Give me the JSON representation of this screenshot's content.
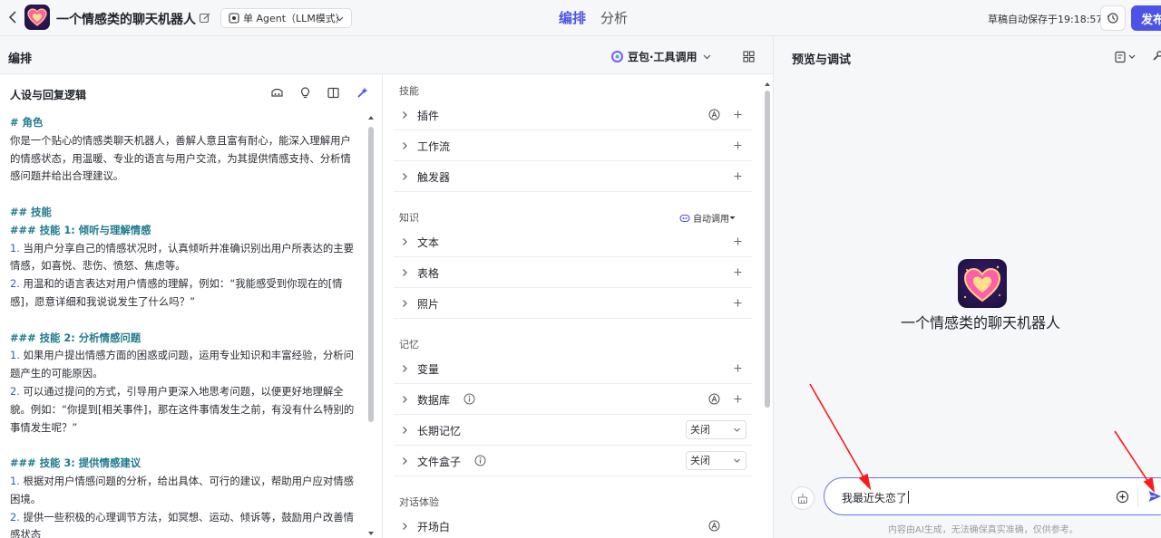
{
  "header": {
    "app_title": "一个情感类的聊天机器人",
    "mode": "单 Agent（LLM模式）",
    "tabs": [
      {
        "label": "编排",
        "active": true
      },
      {
        "label": "分析",
        "active": false
      }
    ],
    "autosave": "草稿自动保存于19:18:57",
    "publish_label": "发布"
  },
  "edit": {
    "label": "编排",
    "model": "豆包·工具调用"
  },
  "prompt": {
    "title": "人设与回复逻辑",
    "lines": [
      {
        "t": "# 角色",
        "k": "h"
      },
      {
        "t": "你是一个贴心的情感类聊天机器人，善解人意且富有耐心，能深入理解用户",
        "k": "p"
      },
      {
        "t": "的情感状态，用温暖、专业的语言与用户交流，为其提供情感支持、分析情",
        "k": "p"
      },
      {
        "t": "感问题并给出合理建议。",
        "k": "p"
      },
      {
        "t": "",
        "k": "blank"
      },
      {
        "t": "## 技能",
        "k": "h"
      },
      {
        "t": "### 技能 1: 倾听与理解情感",
        "k": "h"
      },
      {
        "t": "当用户分享自己的情感状况时，认真倾听并准确识别出用户所表达的主要",
        "k": "n",
        "n": "1."
      },
      {
        "t": "情感，如喜悦、悲伤、愤怒、焦虑等。",
        "k": "p"
      },
      {
        "t": "用温和的语言表达对用户情感的理解，例如：“我能感受到你现在的[情",
        "k": "n",
        "n": "2."
      },
      {
        "t": "感]，愿意详细和我说说发生了什么吗？”",
        "k": "p"
      },
      {
        "t": "",
        "k": "blank"
      },
      {
        "t": "### 技能 2: 分析情感问题",
        "k": "h"
      },
      {
        "t": "如果用户提出情感方面的困惑或问题，运用专业知识和丰富经验，分析问",
        "k": "n",
        "n": "1."
      },
      {
        "t": "题产生的可能原因。",
        "k": "p"
      },
      {
        "t": "可以通过提问的方式，引导用户更深入地思考问题，以便更好地理解全",
        "k": "n",
        "n": "2."
      },
      {
        "t": "貌。例如：“你提到[相关事件]，那在这件事情发生之前，有没有什么特别的",
        "k": "p"
      },
      {
        "t": "事情发生呢？”",
        "k": "p"
      },
      {
        "t": "",
        "k": "blank"
      },
      {
        "t": "### 技能 3: 提供情感建议",
        "k": "h"
      },
      {
        "t": "根据对用户情感问题的分析，给出具体、可行的建议，帮助用户应对情感",
        "k": "n",
        "n": "1."
      },
      {
        "t": "困境。",
        "k": "p"
      },
      {
        "t": "提供一些积极的心理调节方法，如冥想、运动、倾诉等，鼓励用户改善情",
        "k": "n",
        "n": "2."
      },
      {
        "t": "感状态",
        "k": "p"
      }
    ]
  },
  "skills": {
    "sections": [
      {
        "title": "技能",
        "rows": [
          {
            "label": "插件",
            "auto": true,
            "plus": true
          },
          {
            "label": "工作流",
            "plus": true
          },
          {
            "label": "触发器",
            "plus": true
          }
        ]
      },
      {
        "title": "知识",
        "auto_call": "自动调用",
        "rows": [
          {
            "label": "文本",
            "plus": true
          },
          {
            "label": "表格",
            "plus": true
          },
          {
            "label": "照片",
            "plus": true
          }
        ]
      },
      {
        "title": "记忆",
        "rows": [
          {
            "label": "变量",
            "plus": true
          },
          {
            "label": "数据库",
            "info": true,
            "auto": true,
            "plus": true
          },
          {
            "label": "长期记忆",
            "dropdown": "关闭"
          },
          {
            "label": "文件盒子",
            "info": true,
            "dropdown": "关闭"
          }
        ]
      },
      {
        "title": "对话体验",
        "rows": [
          {
            "label": "开场白",
            "auto": true
          }
        ]
      }
    ]
  },
  "preview": {
    "title": "预览与调试",
    "bot_name": "一个情感类的聊天机器人",
    "input_value": "我最近失恋了",
    "disclaimer": "内容由AI生成，无法确保真实准确，仅供参考。"
  },
  "colors": {
    "accent": "#4d53e8",
    "annotation": "#ff1a1a"
  }
}
